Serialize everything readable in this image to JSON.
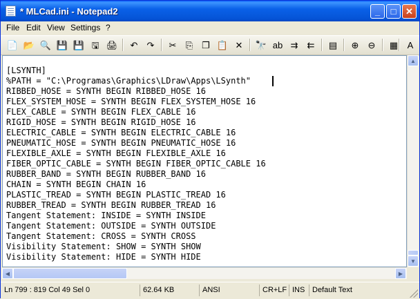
{
  "window": {
    "title": "* MLCad.ini - Notepad2",
    "minimize_glyph": "_",
    "maximize_glyph": "□",
    "close_glyph": "✕"
  },
  "menu": [
    "File",
    "Edit",
    "View",
    "Settings",
    "?"
  ],
  "toolbar_icons": [
    {
      "name": "new-icon",
      "glyph": "📄"
    },
    {
      "name": "open-icon",
      "glyph": "📂"
    },
    {
      "name": "browse-icon",
      "glyph": "🔍"
    },
    {
      "name": "save-icon",
      "glyph": "💾"
    },
    {
      "name": "save-as-icon",
      "glyph": "💾"
    },
    {
      "name": "save-copy-icon",
      "glyph": "🖫"
    },
    {
      "name": "print-icon",
      "glyph": "🖨"
    },
    {
      "name": "undo-icon",
      "glyph": "↶"
    },
    {
      "name": "redo-icon",
      "glyph": "↷"
    },
    {
      "name": "cut-icon",
      "glyph": "✂"
    },
    {
      "name": "copy-icon",
      "glyph": "⎘"
    },
    {
      "name": "copy-all-icon",
      "glyph": "❐"
    },
    {
      "name": "paste-icon",
      "glyph": "📋"
    },
    {
      "name": "delete-icon",
      "glyph": "✕"
    },
    {
      "name": "find-icon",
      "glyph": "🔭"
    },
    {
      "name": "replace-icon",
      "glyph": "ab"
    },
    {
      "name": "find-next-icon",
      "glyph": "⇉"
    },
    {
      "name": "find-prev-icon",
      "glyph": "⇇"
    },
    {
      "name": "goto-icon",
      "glyph": "▤"
    },
    {
      "name": "zoom-in-icon",
      "glyph": "⊕"
    },
    {
      "name": "zoom-out-icon",
      "glyph": "⊖"
    },
    {
      "name": "scheme-icon",
      "glyph": "▦"
    },
    {
      "name": "font-icon",
      "glyph": "A"
    }
  ],
  "editor": {
    "lines": [
      "[LSYNTH]",
      "%PATH = \"C:\\Programas\\Graphics\\LDraw\\Apps\\LSynth\"",
      "RIBBED_HOSE = SYNTH BEGIN RIBBED_HOSE 16",
      "FLEX_SYSTEM_HOSE = SYNTH BEGIN FLEX_SYSTEM_HOSE 16",
      "FLEX_CABLE = SYNTH BEGIN FLEX_CABLE 16",
      "RIGID_HOSE = SYNTH BEGIN RIGID_HOSE 16",
      "ELECTRIC_CABLE = SYNTH BEGIN ELECTRIC_CABLE 16",
      "PNEUMATIC_HOSE = SYNTH BEGIN PNEUMATIC_HOSE 16",
      "FLEXIBLE_AXLE = SYNTH BEGIN FLEXIBLE_AXLE 16",
      "FIBER_OPTIC_CABLE = SYNTH BEGIN FIBER_OPTIC_CABLE 16",
      "RUBBER_BAND = SYNTH BEGIN RUBBER_BAND 16",
      "CHAIN = SYNTH BEGIN CHAIN 16",
      "PLASTIC_TREAD = SYNTH BEGIN PLASTIC_TREAD 16",
      "RUBBER_TREAD = SYNTH BEGIN RUBBER_TREAD 16",
      "Tangent Statement: INSIDE = SYNTH INSIDE",
      "Tangent Statement: OUTSIDE = SYNTH OUTSIDE",
      "Tangent Statement: CROSS = SYNTH CROSS",
      "Visibility Statement: SHOW = SYNTH SHOW",
      "Visibility Statement: HIDE = SYNTH HIDE"
    ]
  },
  "status": {
    "position": "Ln 799 : 819   Col 49   Sel 0",
    "size": "62.64 KB",
    "encoding": "ANSI",
    "line_endings": "CR+LF",
    "mode": "INS",
    "scheme": "Default Text"
  }
}
